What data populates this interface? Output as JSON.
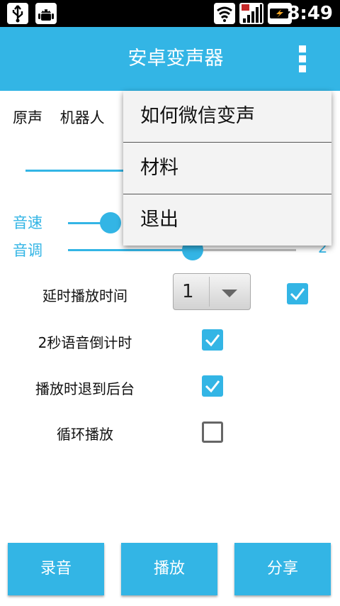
{
  "status_bar": {
    "time": "8:49",
    "icons": [
      "usb-icon",
      "android-debug-icon",
      "wifi-icon",
      "signal-icon",
      "battery-charging-icon"
    ]
  },
  "action_bar": {
    "title": "安卓变声器",
    "overflow_icon": "overflow-menu-icon"
  },
  "voices": [
    "原声",
    "机器人"
  ],
  "params": {
    "speed_label": "音速",
    "pitch_label": "音调",
    "pitch_value": "2"
  },
  "options": [
    {
      "label": "延时播放时间",
      "checked": true
    },
    {
      "label": "2秒语音倒计时",
      "checked": true
    },
    {
      "label": "播放时退到后台",
      "checked": true
    },
    {
      "label": "循环播放",
      "checked": false
    }
  ],
  "delay_spinner": {
    "value": "1"
  },
  "menu": {
    "items": [
      "如何微信变声",
      "材料",
      "退出"
    ]
  },
  "buttons": {
    "record": "录音",
    "play": "播放",
    "share": "分享"
  },
  "colors": {
    "accent": "#33b5e5"
  }
}
